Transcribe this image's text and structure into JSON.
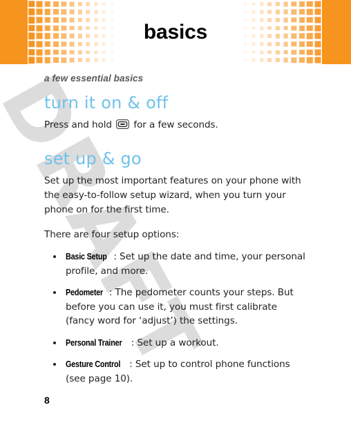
{
  "page": {
    "number": "8",
    "watermark": "DRAFT",
    "watermark_color": "#dcdcdc",
    "background": "#ffffff"
  },
  "banner": {
    "title": "basics",
    "accent_color": "#F6941E",
    "title_color": "#000000",
    "rows": 8,
    "columns": 12
  },
  "subtitle": "a few essential basics",
  "sections": [
    {
      "heading": "turn it on & off",
      "heading_color": "#6FC2EA",
      "paragraphs": [
        {
          "before_icon": "Press and hold ",
          "icon": "power-key-icon",
          "after_icon": " for a few seconds."
        }
      ]
    },
    {
      "heading": "set up & go",
      "heading_color": "#6FC2EA",
      "paragraphs": [
        {
          "text": "Set up the most important features on your phone with the easy-to-follow setup wizard, when you turn your phone on for the first time."
        },
        {
          "text": "There are four setup options:"
        }
      ],
      "bullets": [
        {
          "term": "Basic Setup",
          "text": ": Set up the date and time, your personal profile, and more."
        },
        {
          "term": "Pedometer",
          "text": ": The pedometer counts your steps. But before you can use it, you must first calibrate (fancy word for ‘adjust’) the settings."
        },
        {
          "term": "Personal Trainer",
          "text": ": Set up a workout."
        },
        {
          "term": "Gesture Control",
          "text": ": Set up to control phone functions (see page 10)."
        }
      ]
    }
  ]
}
